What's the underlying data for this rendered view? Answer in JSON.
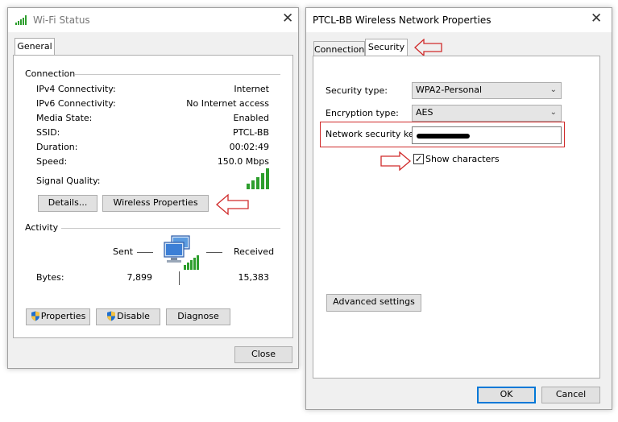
{
  "wifi_status": {
    "title": "Wi-Fi Status",
    "tab": "General",
    "connection_heading": "Connection",
    "fields": [
      {
        "label": "IPv4 Connectivity:",
        "value": "Internet"
      },
      {
        "label": "IPv6 Connectivity:",
        "value": "No Internet access"
      },
      {
        "label": "Media State:",
        "value": "Enabled"
      },
      {
        "label": "SSID:",
        "value": "PTCL-BB"
      },
      {
        "label": "Duration:",
        "value": "00:02:49"
      },
      {
        "label": "Speed:",
        "value": "150.0 Mbps"
      }
    ],
    "signal_label": "Signal Quality:",
    "details_button": "Details...",
    "wireless_properties_button": "Wireless Properties",
    "activity_heading": "Activity",
    "sent_label": "Sent",
    "received_label": "Received",
    "bytes_label": "Bytes:",
    "bytes_sent": "7,899",
    "bytes_received": "15,383",
    "properties_button": "Properties",
    "disable_button": "Disable",
    "diagnose_button": "Diagnose",
    "close_button": "Close"
  },
  "network_properties": {
    "title": "PTCL-BB Wireless Network Properties",
    "tabs": [
      "Connection",
      "Security"
    ],
    "security_type_label": "Security type:",
    "security_type_value": "WPA2-Personal",
    "encryption_type_label": "Encryption type:",
    "encryption_type_value": "AES",
    "network_key_label": "Network security key",
    "show_characters_label": "Show characters",
    "show_characters_checked": true,
    "advanced_settings_button": "Advanced settings",
    "ok_button": "OK",
    "cancel_button": "Cancel"
  },
  "icons": {
    "signal": "signal-bars-icon",
    "network": "network-computers-icon",
    "shield": "uac-shield-icon",
    "arrow": "red-outline-arrow-icon"
  },
  "colors": {
    "signal_green": "#2d9e2d",
    "annotation_red": "#d02a2a",
    "default_button_blue": "#0078d7"
  }
}
